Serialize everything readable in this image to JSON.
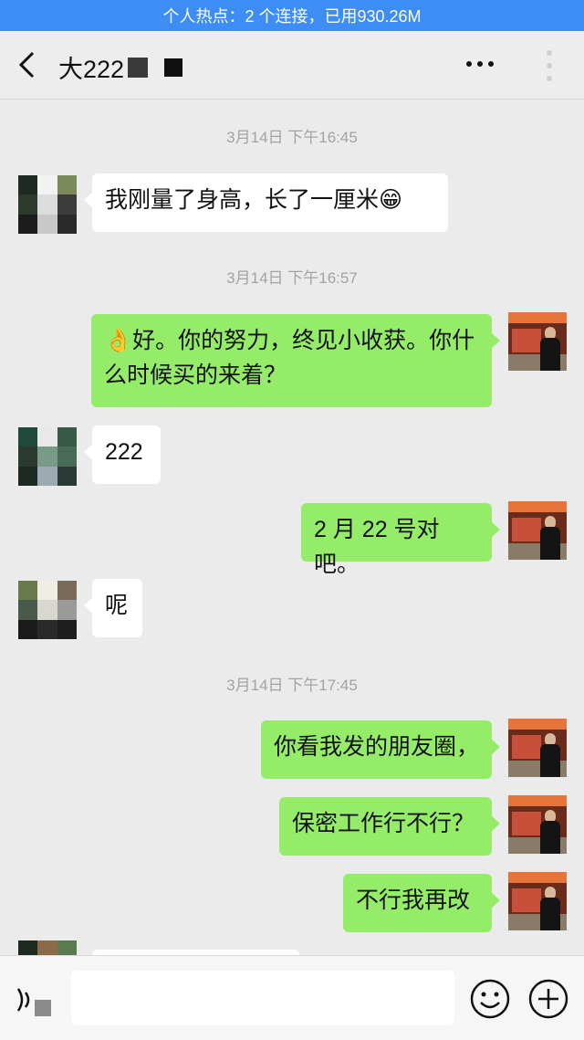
{
  "status_bar": {
    "hotspot_text": "个人热点：2 个连接，已用930.26M"
  },
  "header": {
    "title": "大222",
    "back_icon": "chevron-left-icon",
    "more_icon": "ellipsis-icon"
  },
  "chat": {
    "time_separators": [
      "3月14日 下午16:45",
      "3月14日 下午16:57",
      "3月14日 下午17:45"
    ],
    "messages": [
      {
        "sender": "other",
        "text": "我刚量了身高，长了一厘米😁"
      },
      {
        "sender": "self",
        "text": "👌好。你的努力，终见小收获。你什么时候买的来着？"
      },
      {
        "sender": "other",
        "text": "222"
      },
      {
        "sender": "self",
        "text": "2 月 22 号对吧。"
      },
      {
        "sender": "other",
        "text": "呢"
      },
      {
        "sender": "self",
        "text": "你看我发的朋友圈，"
      },
      {
        "sender": "self",
        "text": "保密工作行不行？"
      },
      {
        "sender": "self",
        "text": "不行我再改"
      },
      {
        "sender": "other",
        "text": ""
      }
    ]
  },
  "input_bar": {
    "voice_icon": "voice-icon",
    "input_value": "",
    "emoji_icon": "smiley-icon",
    "plus_icon": "plus-circle-icon"
  },
  "colors": {
    "hotspot_blue": "#3d8df5",
    "outgoing_bubble": "#95ec69",
    "incoming_bubble": "#ffffff",
    "chat_background": "#ebebeb"
  }
}
